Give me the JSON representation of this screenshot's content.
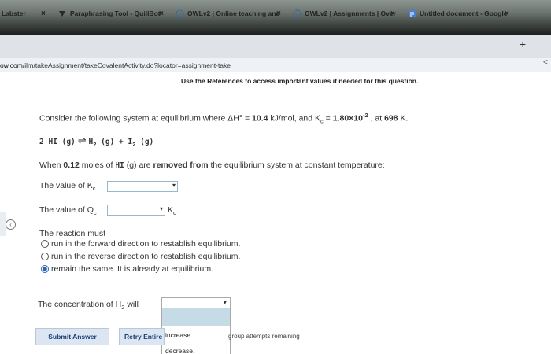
{
  "browser": {
    "tabs": [
      {
        "label": "Labster",
        "icon": "none"
      },
      {
        "label": "Paraphrasing Tool - QuillBot",
        "icon": "quillbot-icon"
      },
      {
        "label": "OWLv2 | Online teaching and",
        "icon": "owl-icon"
      },
      {
        "label": "OWLv2 | Assignments | Over",
        "icon": "owl-icon"
      },
      {
        "label": "Untitled document - Google",
        "icon": "docs-icon"
      }
    ],
    "tab_close": "×",
    "new_tab": "+",
    "url_domain": "ow.com",
    "url_path": "/ilrn/takeAssignment/takeCovalentActivity.do?locator=assignment-take"
  },
  "question": {
    "references_note": "Use the References to access important values if needed for this question.",
    "intro": "Consider the following system at equilibrium where ΔH° = ",
    "dh_value": "10.4",
    "dh_unit": " kJ/mol, and K",
    "kc_sub": "c",
    "kc_eq": " = ",
    "kc_value": "1.80×10",
    "kc_exp": "-2",
    "kc_tail": " , at ",
    "temp": "698",
    "temp_unit": " K.",
    "reaction_lhs": "2 HI (g)",
    "reaction_arrow": "⇌",
    "reaction_rhs_1": "H",
    "reaction_rhs_1_sub": "2",
    "reaction_rhs_1_state": " (g) + ",
    "reaction_rhs_2": "I",
    "reaction_rhs_2_sub": "2",
    "reaction_rhs_2_state": " (g)",
    "change_pre": "When ",
    "change_amount": "0.12",
    "change_mid": " moles of ",
    "change_species": "HI",
    "change_state": " (g) are ",
    "change_action": "removed from",
    "change_post": " the equilibrium system at constant temperature:",
    "kc_label": "The value of K",
    "kc_label_sub": "c",
    "qc_label": "The value of Q",
    "qc_label_sub": "c",
    "qc_suffix": "K",
    "qc_suffix_sub": "c",
    "qc_suffix_dot": ".",
    "reaction_must": "The reaction must",
    "options": [
      {
        "label": "run in the forward direction to restablish equilibrium.",
        "selected": false
      },
      {
        "label": "run in the reverse direction to restablish equilibrium.",
        "selected": false
      },
      {
        "label": "remain the same.  It is already at equilibrium.",
        "selected": true
      }
    ],
    "concentration_label": "The concentration of H",
    "concentration_sub": "2",
    "concentration_tail": " will",
    "dropdown_options": [
      "increase.",
      "decrease."
    ]
  },
  "actions": {
    "submit": "Submit Answer",
    "retry": "Retry Entire",
    "group_note": "group attempts remaining"
  },
  "colors": {
    "accent": "#2a63b3",
    "button_text": "#1c3e75",
    "button_bg": "#dbe6f2",
    "highlight": "#c5dce6"
  }
}
